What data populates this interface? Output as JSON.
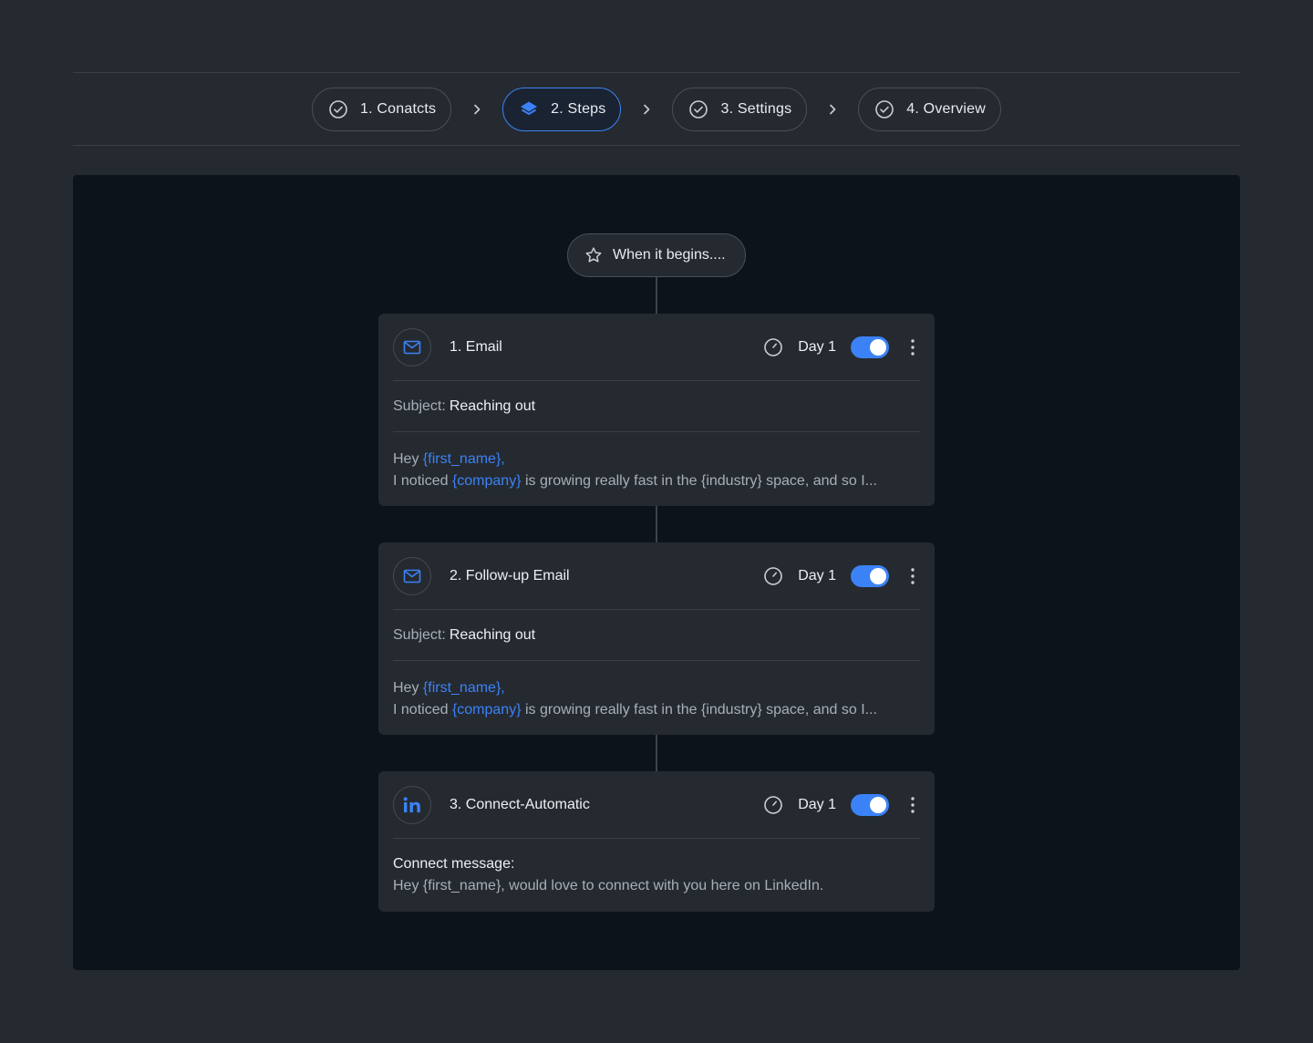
{
  "stepper": {
    "steps": [
      {
        "label": "1. Conatcts",
        "state": "completed",
        "icon": "check-circle-icon"
      },
      {
        "label": "2. Steps",
        "state": "active",
        "icon": "layers-icon"
      },
      {
        "label": "3. Settings",
        "state": "completed",
        "icon": "check-circle-icon"
      },
      {
        "label": "4. Overview",
        "state": "completed",
        "icon": "check-circle-icon"
      }
    ]
  },
  "flow": {
    "start_label": "When it begins....",
    "steps": [
      {
        "title": "1. Email",
        "icon": "mail-icon",
        "day": "Day 1",
        "enabled": true,
        "subject_label": "Subject:",
        "subject": "Reaching out",
        "greeting": "Hey",
        "greeting_var": "{first_name},",
        "line_prefix": "I noticed",
        "line_var": "{company}",
        "line_rest": "is growing really fast in the {industry} space, and so I..."
      },
      {
        "title": "2. Follow-up Email",
        "icon": "mail-icon",
        "day": "Day 1",
        "enabled": true,
        "subject_label": "Subject:",
        "subject": "Reaching out",
        "greeting": "Hey",
        "greeting_var": "{first_name},",
        "line_prefix": "I noticed",
        "line_var": "{company}",
        "line_rest": "is growing really fast in the {industry} space, and so I..."
      },
      {
        "title": "3. Connect-Automatic",
        "icon": "linkedin-icon",
        "day": "Day 1",
        "enabled": true,
        "message_label": "Connect message:",
        "message": "Hey {first_name}, would love to connect with you here on LinkedIn."
      }
    ]
  },
  "colors": {
    "accent": "#3b82f6",
    "page_bg": "#252a31",
    "canvas_bg": "#0d131a",
    "card_bg": "#252a31"
  }
}
